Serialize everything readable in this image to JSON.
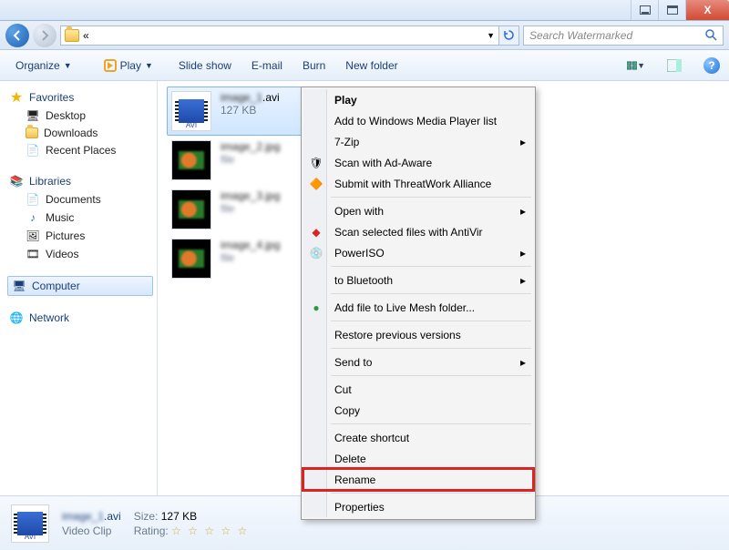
{
  "titlebar": {
    "close": "X"
  },
  "nav": {
    "breadcrumb": "«",
    "search_placeholder": "Search Watermarked"
  },
  "cmd": {
    "organize": "Organize",
    "play": "Play",
    "slideshow": "Slide show",
    "email": "E-mail",
    "burn": "Burn",
    "newfolder": "New folder"
  },
  "sidebar": {
    "favorites": "Favorites",
    "desktop": "Desktop",
    "downloads": "Downloads",
    "recent": "Recent Places",
    "libraries": "Libraries",
    "documents": "Documents",
    "music": "Music",
    "pictures": "Pictures",
    "videos": "Videos",
    "computer": "Computer",
    "network": "Network"
  },
  "files": {
    "sel_name": ".avi",
    "sel_name_prefix_blur": "image_1",
    "sel_size": "127 KB",
    "avi_tag": "AVI"
  },
  "context_menu": {
    "play": "Play",
    "add_wmp": "Add to Windows Media Player list",
    "sevenzip": "7-Zip",
    "adaware": "Scan with Ad-Aware",
    "threatwork": "Submit with ThreatWork Alliance",
    "openwith": "Open with",
    "antivir": "Scan selected files with AntiVir",
    "poweriso": "PowerISO",
    "bluetooth": "to Bluetooth",
    "livemesh": "Add file to Live Mesh folder...",
    "restore": "Restore previous versions",
    "sendto": "Send to",
    "cut": "Cut",
    "copy": "Copy",
    "shortcut": "Create shortcut",
    "delete": "Delete",
    "rename": "Rename",
    "properties": "Properties"
  },
  "details": {
    "name_suffix": ".avi",
    "type": "Video Clip",
    "size_label": "Size:",
    "size_value": "127 KB",
    "rating_label": "Rating:",
    "rating_stars": "☆ ☆ ☆ ☆ ☆"
  }
}
